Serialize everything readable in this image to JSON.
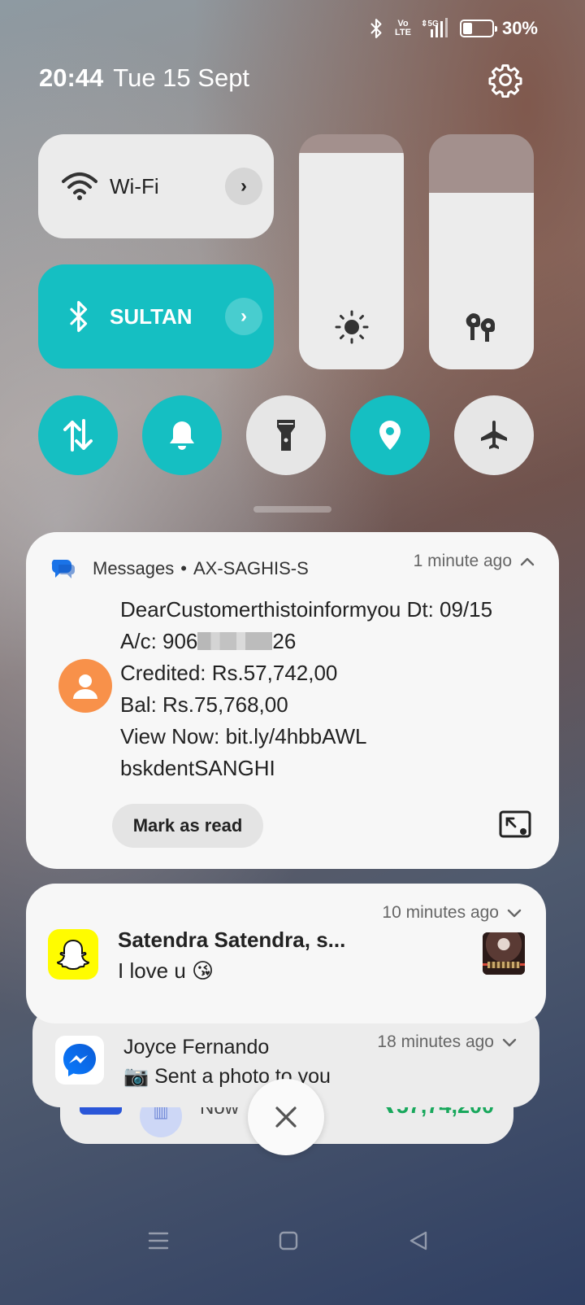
{
  "status_bar": {
    "battery_percent": "30%",
    "battery_level": 0.3,
    "network": "5G",
    "volte_line1": "Vo",
    "volte_line2": "LTE",
    "icons": [
      "bluetooth-icon",
      "volte-icon",
      "signal-icon",
      "battery-icon"
    ]
  },
  "header": {
    "time": "20:44",
    "date": "Tue 15 Sept"
  },
  "quick_settings": {
    "wifi": {
      "label": "Wi-Fi",
      "active": false
    },
    "bluetooth": {
      "label": "SULTAN",
      "active": true
    },
    "brightness_level": 0.92,
    "volume_level": 0.75,
    "toggles": [
      {
        "name": "mobile-data",
        "icon": "data-arrows-icon",
        "active": true
      },
      {
        "name": "notifications",
        "icon": "bell-icon",
        "active": true
      },
      {
        "name": "flashlight",
        "icon": "flashlight-icon",
        "active": false
      },
      {
        "name": "location",
        "icon": "location-icon",
        "active": true
      },
      {
        "name": "airplane",
        "icon": "airplane-icon",
        "active": false
      }
    ],
    "accent_color": "#15bfc2"
  },
  "notifications": {
    "messages": {
      "app": "Messages",
      "separator": "•",
      "sender": "AX-SAGHIS-S",
      "time": "1 minute ago",
      "lines": [
        "DearCustomerthistoinformyou Dt: 09/15",
        "Credited: Rs.57,742,00",
        "Bal: Rs.75,768,00",
        "View Now: bit.ly/4hbbAWL",
        "bskdentSANGHI"
      ],
      "account_prefix": "A/c: 906",
      "account_suffix": "26",
      "action": "Mark as read"
    },
    "snapchat": {
      "title": "Satendra Satendra, s...",
      "text": "I love u 😘",
      "time": "10 minutes ago"
    },
    "messenger": {
      "title": "Joyce Fernando",
      "text": "📷 Sent a photo to you",
      "time": "18 minutes ago"
    },
    "background": {
      "label": "Now",
      "amount": "₹57,74,200"
    }
  }
}
